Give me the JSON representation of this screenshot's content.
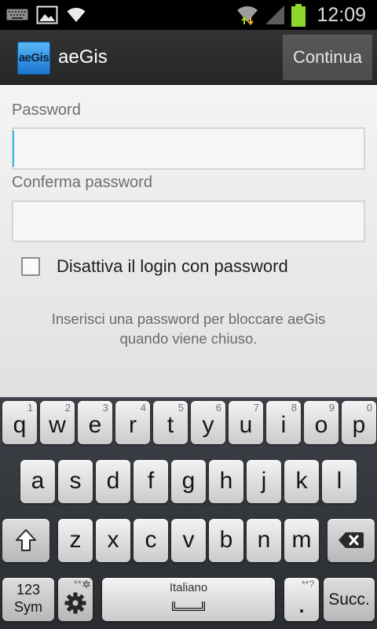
{
  "status_bar": {
    "left_icons": [
      "keyboard-icon",
      "gallery-icon",
      "wifi-icon"
    ],
    "right_icons": [
      "wifi-data-activity-icon",
      "cell-signal-icon",
      "battery-icon"
    ],
    "time": "12:09"
  },
  "action_bar": {
    "app_icon": "app-logo-icon",
    "app_icon_text": "aeGis",
    "title": "aeGis",
    "continue_label": "Continua"
  },
  "form": {
    "password_label": "Password",
    "password_value": "",
    "confirm_label": "Conferma password",
    "confirm_value": "",
    "disable_login_label": "Disattiva il login con password",
    "disable_login_checked": false,
    "info_line_1": "Inserisci una password per bloccare aeGis",
    "info_line_2": "quando viene chiuso."
  },
  "keyboard": {
    "row1": [
      {
        "key": "q",
        "hint": "1"
      },
      {
        "key": "w",
        "hint": "2"
      },
      {
        "key": "e",
        "hint": "3"
      },
      {
        "key": "r",
        "hint": "4"
      },
      {
        "key": "t",
        "hint": "5"
      },
      {
        "key": "y",
        "hint": "6"
      },
      {
        "key": "u",
        "hint": "7"
      },
      {
        "key": "i",
        "hint": "8"
      },
      {
        "key": "o",
        "hint": "9"
      },
      {
        "key": "p",
        "hint": "0"
      }
    ],
    "row2": [
      "a",
      "s",
      "d",
      "f",
      "g",
      "h",
      "j",
      "k",
      "l"
    ],
    "row3": [
      "z",
      "x",
      "c",
      "v",
      "b",
      "n",
      "m"
    ],
    "shift_icon": "shift-arrow-icon",
    "backspace_icon": "backspace-icon",
    "sym_line_1": "123",
    "sym_line_2": "Sym",
    "settings_icon": "gear-icon",
    "settings_hint": "**",
    "space_label": "Italiano",
    "space_icon": "space-bar-icon",
    "period_label": ".",
    "period_hint": "**?",
    "enter_label": "Succ."
  },
  "colors": {
    "accent": "#33b5e5",
    "battery": "#8dd62c",
    "app_icon_blue": "#2a8de0",
    "action_bar": "#2b2b2b",
    "keyboard_bg": "#33363b"
  }
}
